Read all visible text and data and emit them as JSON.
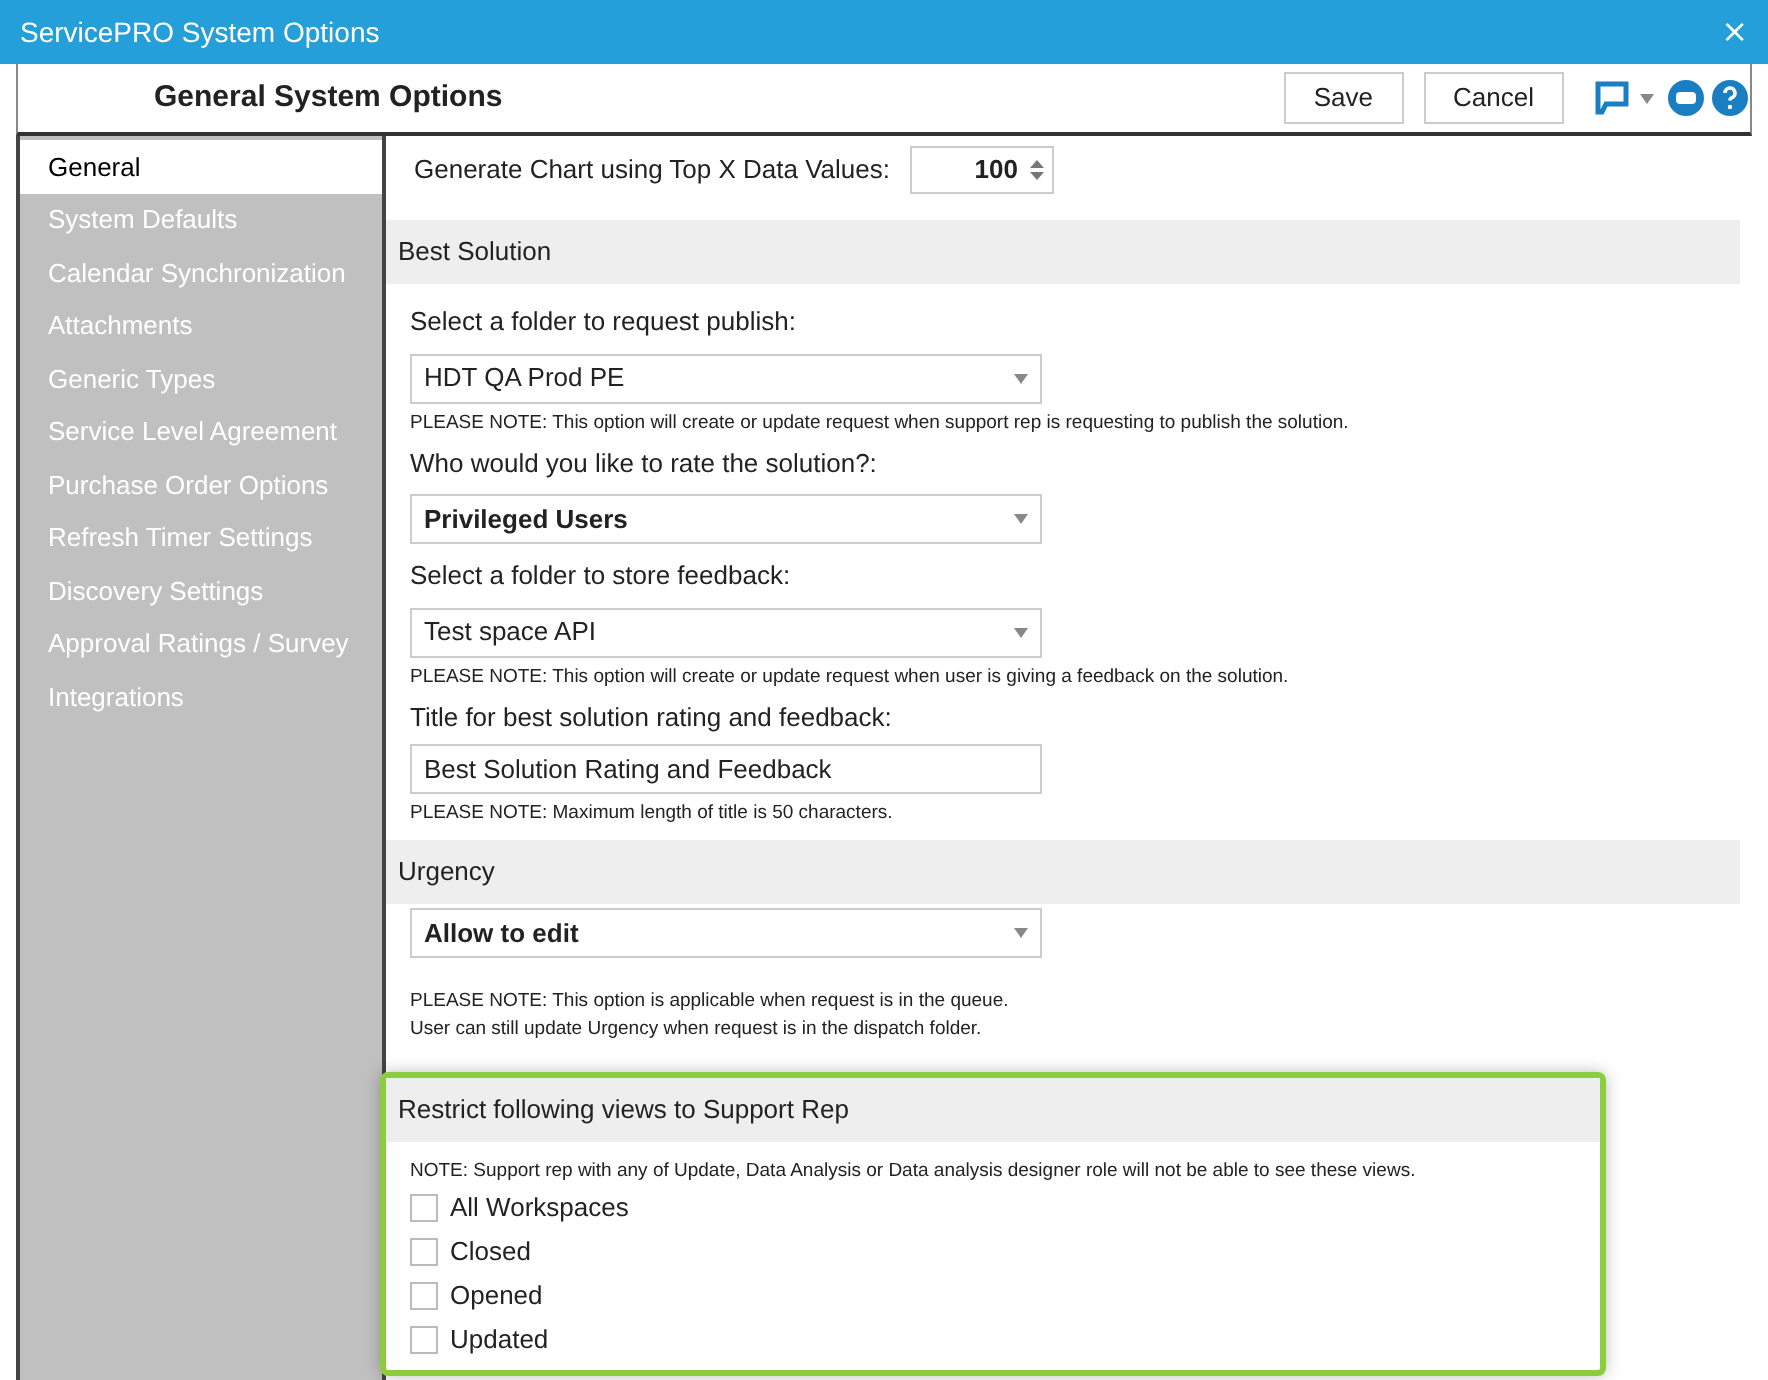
{
  "window": {
    "title": "ServicePRO  System Options",
    "close": "×"
  },
  "header": {
    "title": "General System Options",
    "buttons": [
      "Save",
      "Cancel"
    ]
  },
  "sidebar": {
    "items": [
      {
        "label": "General",
        "selected": true
      },
      {
        "label": "System Defaults",
        "selected": false
      },
      {
        "label": "Calendar Synchronization",
        "selected": false
      },
      {
        "label": "Attachments",
        "selected": false
      },
      {
        "label": "Generic Types",
        "selected": false
      },
      {
        "label": "Service Level Agreement",
        "selected": false
      },
      {
        "label": "Purchase Order Options",
        "selected": false
      },
      {
        "label": "Refresh Timer Settings",
        "selected": false
      },
      {
        "label": "Discovery Settings",
        "selected": false
      },
      {
        "label": "Approval Ratings / Survey",
        "selected": false
      },
      {
        "label": "Integrations",
        "selected": false
      }
    ]
  },
  "content": {
    "top": {
      "label": "Generate Chart using Top X Data Values:",
      "value": "100"
    },
    "sections": [
      {
        "title": "Best Solution",
        "highlighted": false,
        "items": [
          {
            "kind": "label",
            "text": "Select a folder to request publish:"
          },
          {
            "kind": "dropdown",
            "value": "HDT QA Prod PE",
            "bold": false
          },
          {
            "kind": "note",
            "text": "PLEASE NOTE: This option will create or update request when support rep is requesting to publish the solution."
          },
          {
            "kind": "label",
            "text": "Who would you like to rate the solution?:"
          },
          {
            "kind": "dropdown",
            "value": "Privileged Users",
            "bold": true
          },
          {
            "kind": "label",
            "text": "Select a folder to store feedback:"
          },
          {
            "kind": "dropdown",
            "value": "Test space API",
            "bold": false
          },
          {
            "kind": "note",
            "text": "PLEASE NOTE: This option will create or update request when user is giving a feedback on the solution."
          },
          {
            "kind": "label",
            "text": "Title for best solution rating and feedback:"
          },
          {
            "kind": "text_field",
            "value": "Best Solution Rating and Feedback"
          },
          {
            "kind": "note",
            "text": "PLEASE NOTE: Maximum length of title is 50 characters."
          }
        ]
      },
      {
        "title": "Urgency",
        "highlighted": false,
        "items": [
          {
            "kind": "dropdown",
            "value": "Allow to edit",
            "bold": true
          },
          {
            "kind": "gap"
          },
          {
            "kind": "note",
            "text": "PLEASE NOTE: This option is applicable when request is in the queue."
          },
          {
            "kind": "note",
            "text": "User can still update Urgency when request is in the dispatch folder."
          }
        ]
      },
      {
        "title": "Restrict following views to Support Rep",
        "highlighted": true,
        "items": [
          {
            "kind": "note",
            "text": "NOTE: Support rep with any of Update, Data Analysis or Data analysis designer role will not be able to see these views."
          },
          {
            "kind": "checkbox",
            "label": "All Workspaces",
            "checked": false
          },
          {
            "kind": "checkbox",
            "label": "Closed",
            "checked": false
          },
          {
            "kind": "checkbox",
            "label": "Opened",
            "checked": false
          },
          {
            "kind": "checkbox",
            "label": "Updated",
            "checked": false
          }
        ]
      }
    ]
  }
}
